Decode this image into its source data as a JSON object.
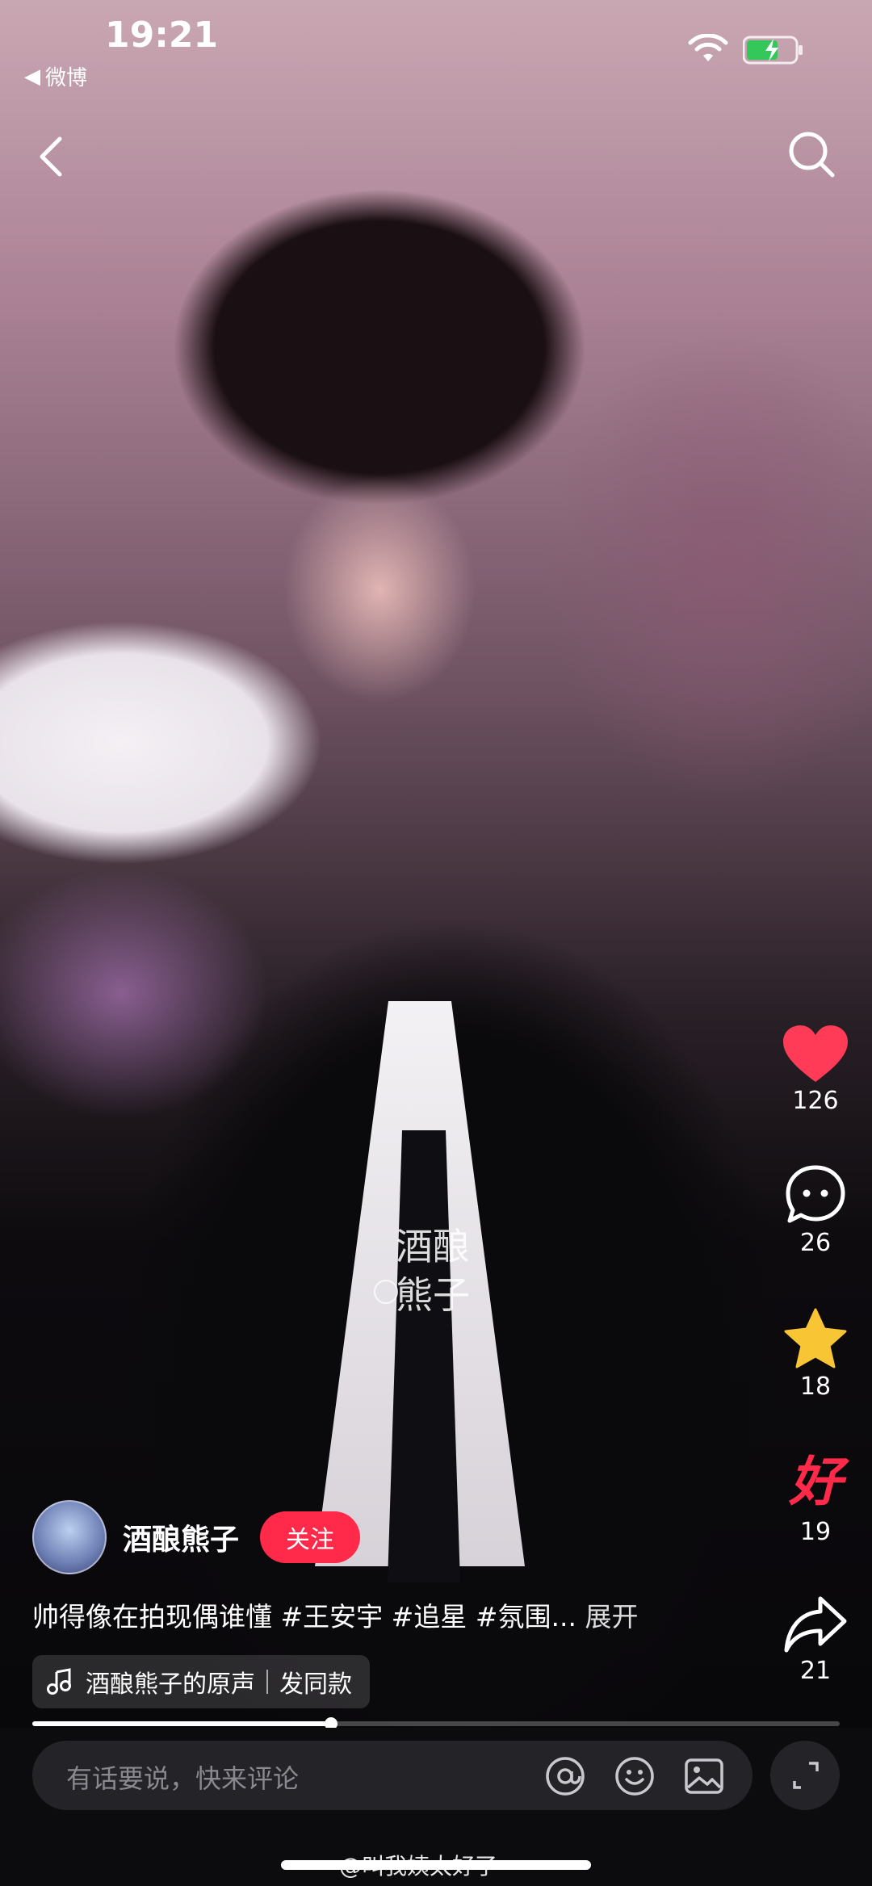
{
  "status_bar": {
    "time": "19:21",
    "back_app": "微博"
  },
  "video": {
    "watermark_text_1": "酒酿",
    "watermark_text_2": "熊子"
  },
  "actions": {
    "like": {
      "count": "126",
      "icon": "heart-icon",
      "color": "#ff3b57"
    },
    "comment": {
      "count": "26",
      "icon": "comment-bubble-icon"
    },
    "favorite": {
      "count": "18",
      "icon": "star-icon",
      "color": "#f8c534"
    },
    "good": {
      "label": "好",
      "count": "19",
      "color": "#ff2a4a"
    },
    "share": {
      "count": "21",
      "icon": "share-arrow-icon"
    }
  },
  "author": {
    "name": "酒酿熊子",
    "follow_label": "关注"
  },
  "caption": {
    "text": "帅得像在拍现偶谁懂",
    "tags": [
      "#王安宇",
      "#追星",
      "#氛围..."
    ],
    "expand_label": "展开"
  },
  "music": {
    "title": "酒酿熊子的原声",
    "action": "发同款"
  },
  "progress": {
    "fraction": 0.37
  },
  "comment_bar": {
    "placeholder": "有话要说，快来评论"
  },
  "footer_watermark": "@叫我姨太好了"
}
